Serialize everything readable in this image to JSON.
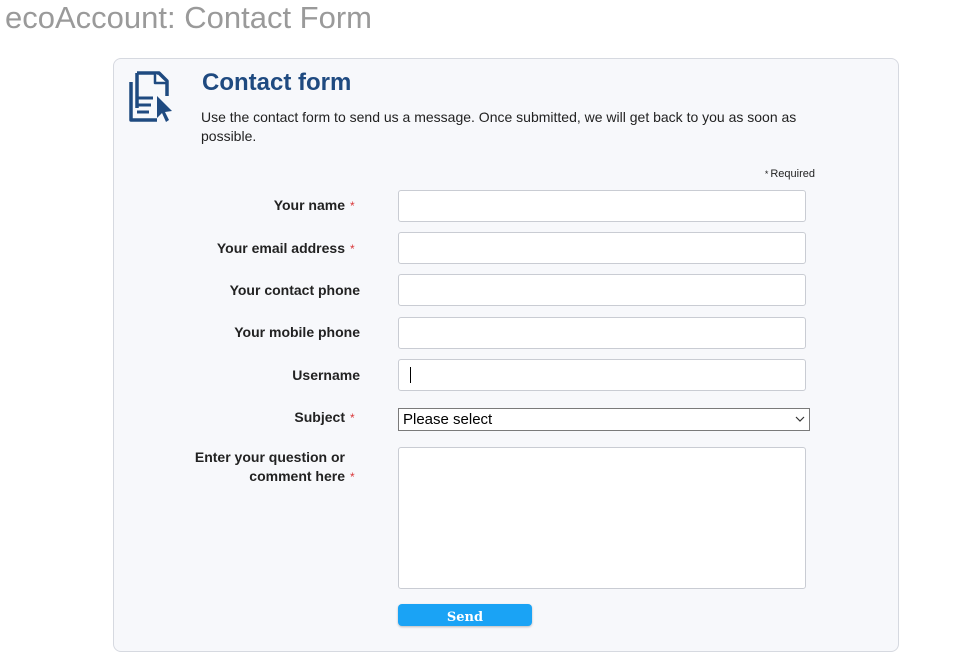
{
  "page": {
    "title": "ecoAccount: Contact Form"
  },
  "form": {
    "heading": "Contact form",
    "intro": "Use the contact form to send us a message. Once submitted, we will get back to you as soon as possible.",
    "icon": "form-document-pointer-icon",
    "required_marker": "*",
    "required_note": "Required",
    "fields": [
      {
        "label": "Your name",
        "required": true,
        "value": "",
        "placeholder": ""
      },
      {
        "label": "Your email address",
        "required": true,
        "value": "",
        "placeholder": ""
      },
      {
        "label": "Your contact phone",
        "required": false,
        "value": "",
        "placeholder": ""
      },
      {
        "label": "Your mobile phone",
        "required": false,
        "value": "",
        "placeholder": ""
      },
      {
        "label": "Username",
        "required": false,
        "value": "",
        "placeholder": "",
        "focused": true
      }
    ],
    "subject": {
      "label": "Subject",
      "required": true,
      "selected": "Please select"
    },
    "message": {
      "label_line1": "Enter your question or",
      "label_line2": "comment here",
      "required": true,
      "value": ""
    },
    "send_label": "Send"
  },
  "colors": {
    "title": "#9a9a9a",
    "heading": "#1f4a80",
    "icon": "#1f4a80",
    "required_star": "#d9383a",
    "panel_bg": "#f7f8fb",
    "button": "#1aa3f5"
  }
}
